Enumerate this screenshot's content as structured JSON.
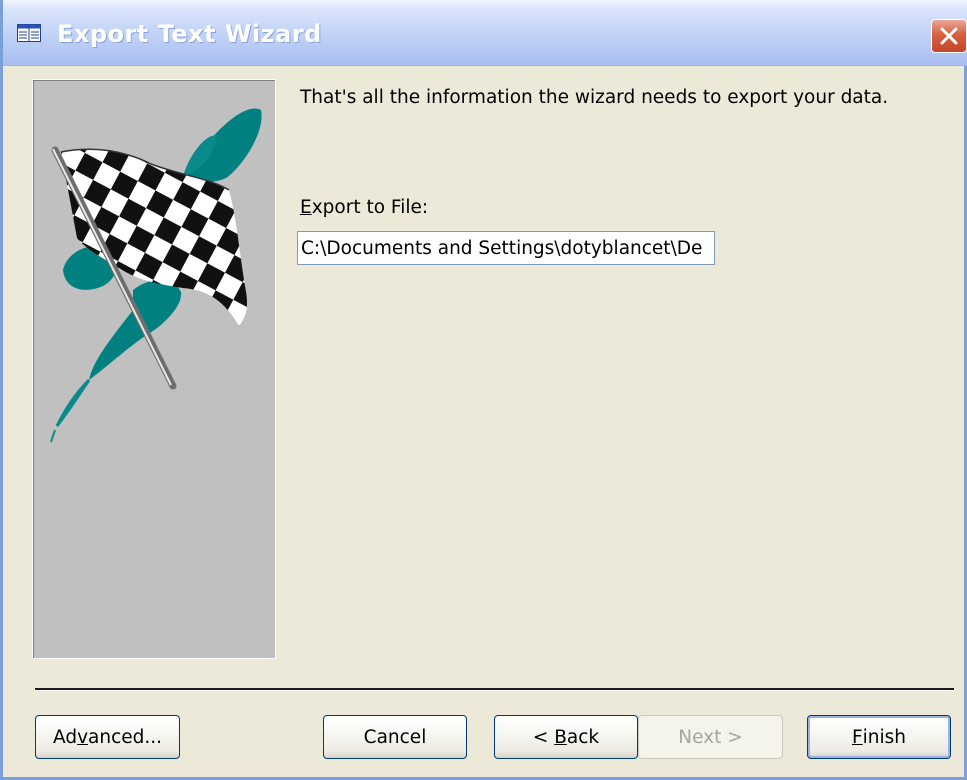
{
  "window": {
    "title": "Export Text Wizard",
    "colors": {
      "titlebar": "#b5c9f3",
      "close": "#d8603f",
      "face": "#ece9d8",
      "panel": "#c0c0c0",
      "accent_teal": "#008080"
    },
    "icons": {
      "app": "table-icon",
      "close": "close-icon",
      "wizard_art": "checkered-flag-icon"
    }
  },
  "main": {
    "intro_text": "That's all the information the wizard needs to export your data.",
    "export_label_pre": "",
    "export_label_hotkey": "E",
    "export_label_post": "xport to File:",
    "export_path": "C:\\Documents and Settings\\dotyblancet\\De"
  },
  "buttons": {
    "advanced_pre": "Ad",
    "advanced_hotkey": "v",
    "advanced_post": "anced...",
    "cancel": "Cancel",
    "back_pre": "< ",
    "back_hotkey": "B",
    "back_post": "ack",
    "next": "Next >",
    "finish_hotkey": "F",
    "finish_post": "inish"
  }
}
